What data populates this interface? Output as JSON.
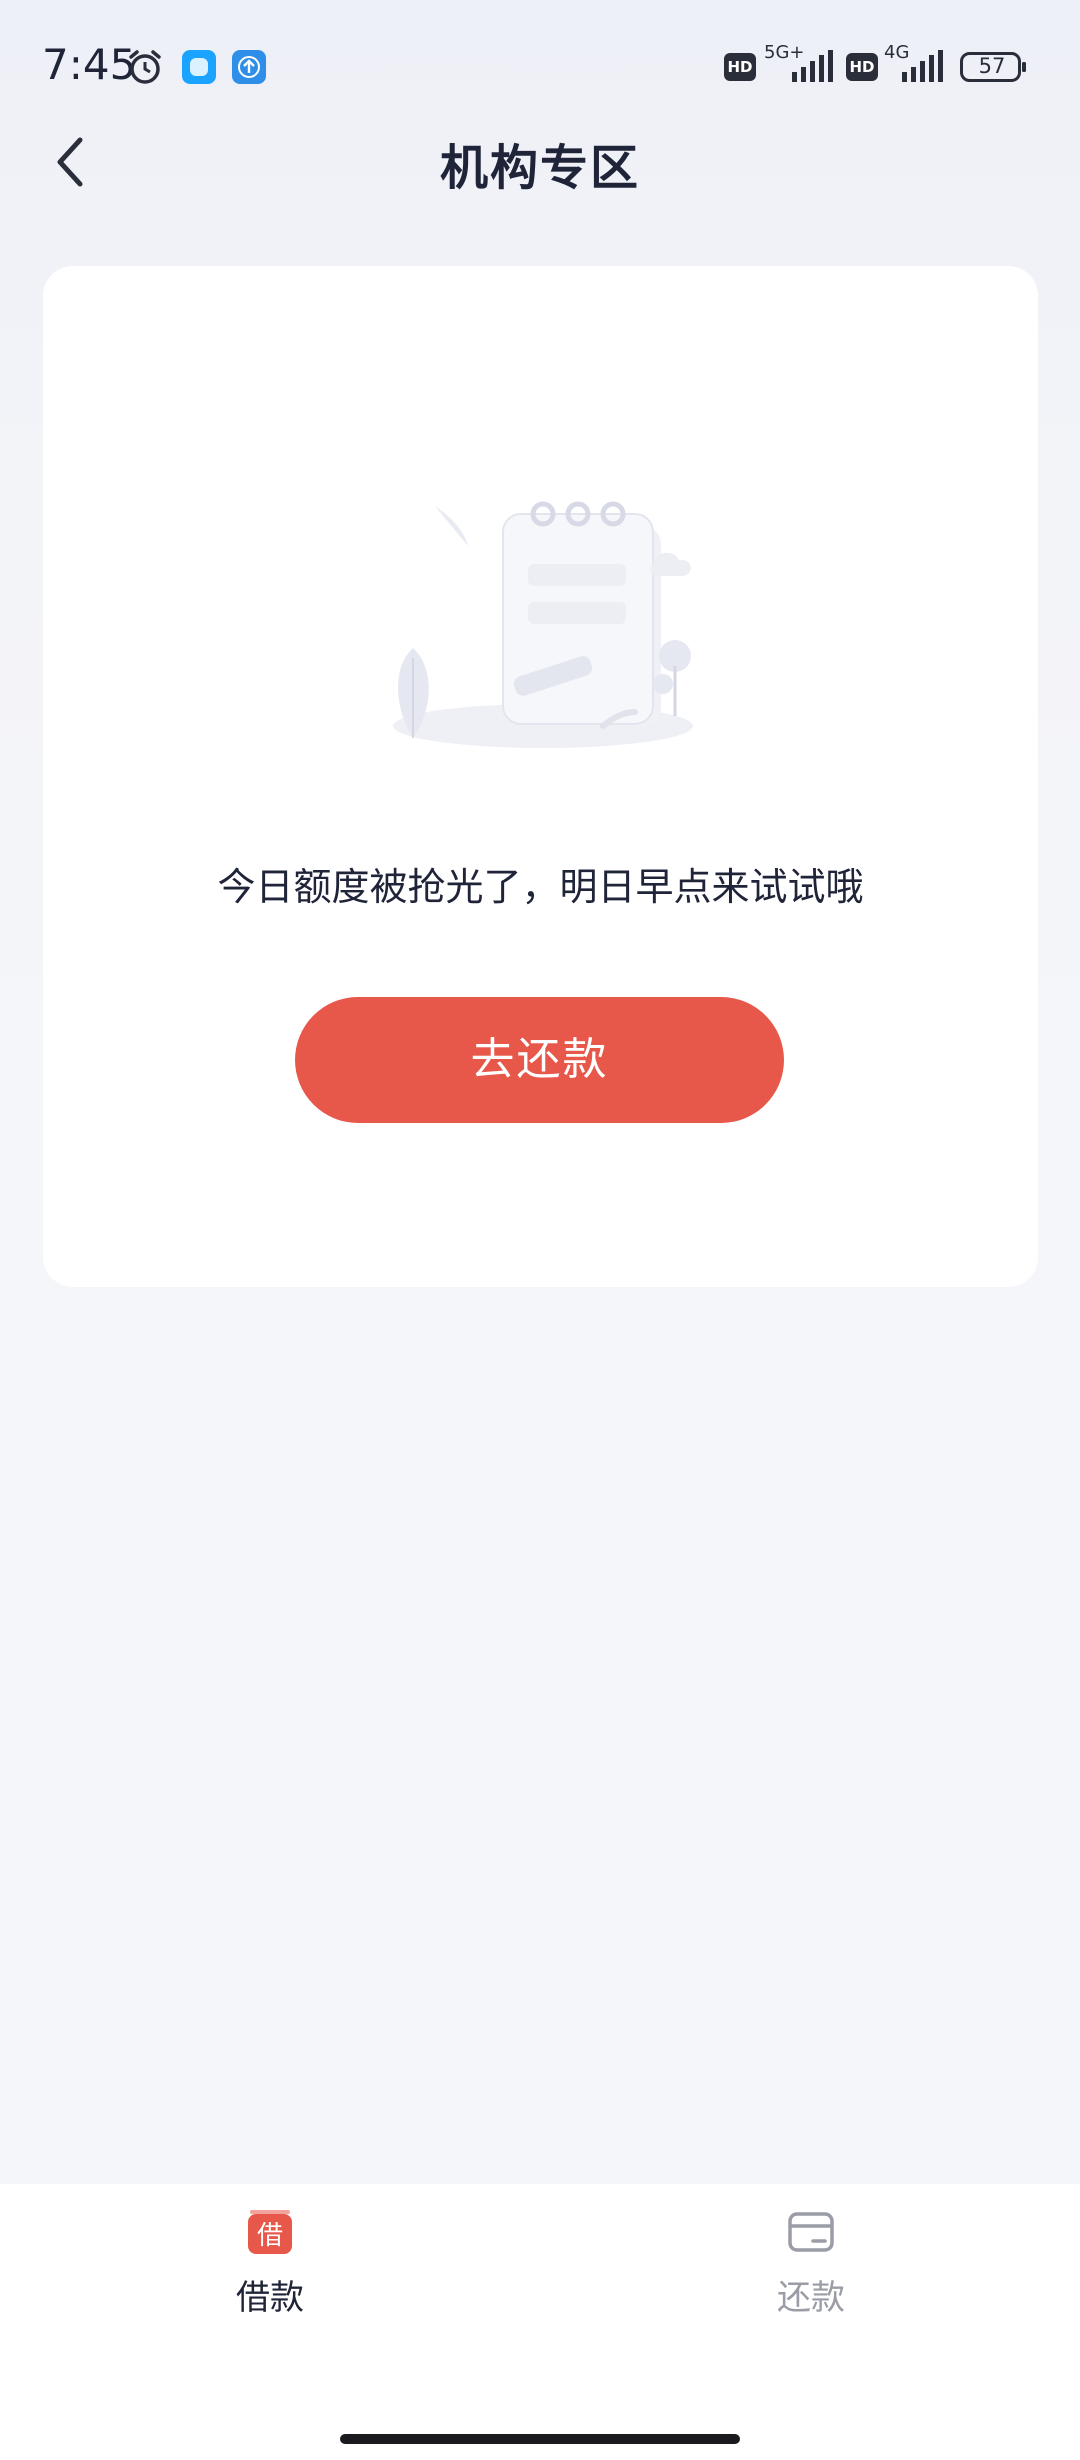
{
  "status_bar": {
    "time": "7:45",
    "hd1": "HD",
    "net1": "5G+",
    "hd2": "HD",
    "net2": "4G",
    "battery": "57"
  },
  "header": {
    "title": "机构专区"
  },
  "card": {
    "message": "今日额度被抢光了，明日早点来试试哦",
    "button_label": "去还款"
  },
  "bottom_nav": {
    "items": [
      {
        "label": "借款",
        "icon_text": "借",
        "icon": "borrow-icon",
        "active": true
      },
      {
        "label": "还款",
        "icon": "card-icon",
        "active": false
      }
    ]
  },
  "colors": {
    "accent": "#e8584a",
    "text": "#1f2438",
    "inactive": "#9a9ca6"
  }
}
